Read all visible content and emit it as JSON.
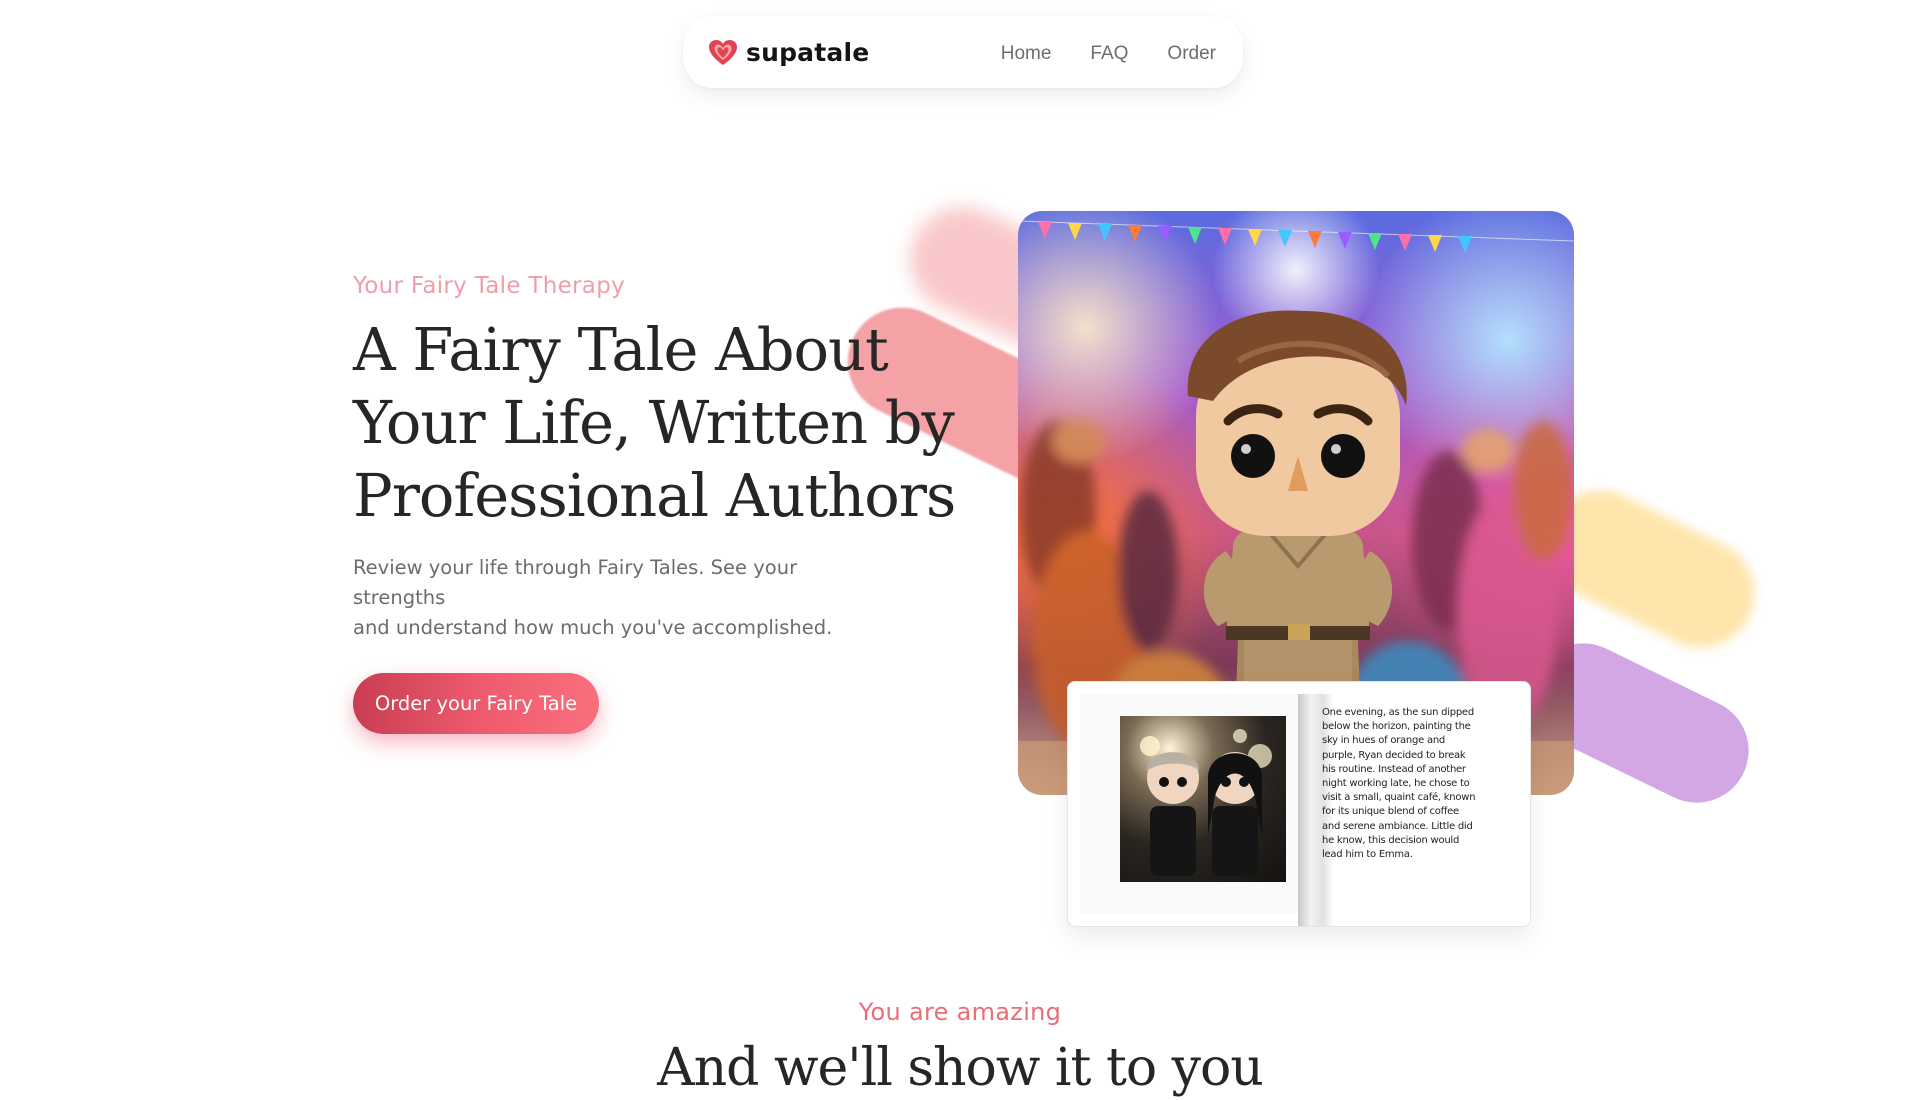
{
  "nav": {
    "brand": "supatale",
    "links": [
      "Home",
      "FAQ",
      "Order"
    ]
  },
  "hero": {
    "eyebrow": "Your Fairy Tale Therapy",
    "title_lines": [
      "A Fairy Tale About",
      "Your Life, Written by",
      "Professional Authors"
    ],
    "subtitle_lines": [
      "Review your life through Fairy Tales. See your strengths",
      "and understand how much you've accomplished."
    ],
    "cta": "Order your Fairy Tale"
  },
  "book": {
    "text_lines": [
      "One evening, as the sun dipped",
      "below the horizon, painting the",
      "sky in hues of orange and",
      "purple, Ryan decided to break",
      "his routine. Instead of another",
      "night working late, he chose to",
      "visit a small, quaint café, known",
      "for its unique blend of coffee",
      "and serene ambiance. Little did",
      "he know, this decision would",
      "lead him to Emma."
    ]
  },
  "section2": {
    "eyebrow": "You are amazing",
    "title": "And we'll show it to you"
  },
  "colors": {
    "accent": "#ea6e78",
    "eyebrow_pink": "#ee9eaa",
    "cta_gradient_start": "#c93d52",
    "cta_gradient_end": "#f9707d",
    "stroke_pink": "#f4a2a6",
    "stroke_yellow": "#ffe2a3",
    "stroke_purple": "#d3a6e6"
  },
  "icons": {
    "logo": "heart-icon"
  }
}
